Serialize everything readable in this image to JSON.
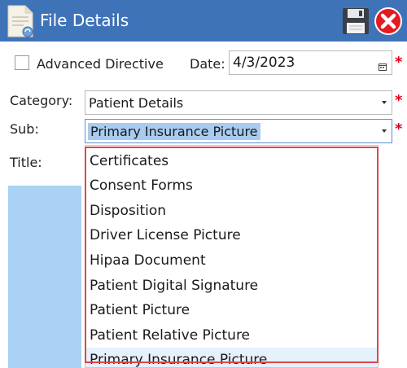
{
  "window": {
    "title": "File Details",
    "title_icon": "document-icon",
    "save_icon": "floppy-disk-icon",
    "close_icon": "close-icon"
  },
  "form": {
    "advanced_directive_label": "Advanced Directive",
    "advanced_directive_checked": false,
    "date_label": "Date:",
    "date_value": "4/3/2023",
    "category_label": "Category:",
    "category_value": "Patient Details",
    "sub_label": "Sub:",
    "sub_value": "Primary Insurance Picture",
    "title_label": "Title:",
    "required_marker": "*"
  },
  "dropdown": {
    "options": [
      "Certificates",
      "Consent Forms",
      "Disposition",
      "Driver License Picture",
      "Hipaa Document",
      "Patient Digital Signature",
      "Patient Picture",
      "Patient Relative Picture",
      "Primary Insurance Picture"
    ],
    "selected": "Primary Insurance Picture"
  },
  "colors": {
    "titlebar": "#3f73b8",
    "required": "#e0001b",
    "highlight_border": "#e0464a",
    "selection": "#a8cbef"
  }
}
